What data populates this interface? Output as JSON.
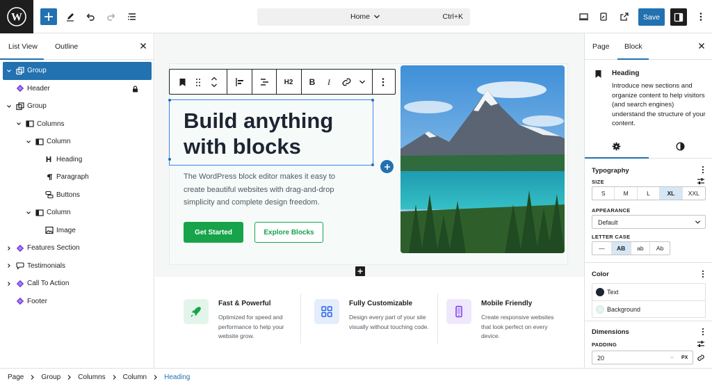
{
  "topbar": {
    "document_title": "Home",
    "shortcut": "Ctrl+K",
    "save_label": "Save"
  },
  "list_view": {
    "tabs": [
      "List View",
      "Outline"
    ],
    "items": [
      {
        "label": "Group",
        "level": 0,
        "chevron": "down",
        "icon": "group",
        "selected": true
      },
      {
        "label": "Header",
        "level": 0,
        "chevron": "none",
        "icon": "pattern",
        "locked": true
      },
      {
        "label": "Group",
        "level": 0,
        "chevron": "down",
        "icon": "group"
      },
      {
        "label": "Columns",
        "level": 1,
        "chevron": "down",
        "icon": "columns"
      },
      {
        "label": "Column",
        "level": 2,
        "chevron": "down",
        "icon": "column"
      },
      {
        "label": "Heading",
        "level": 3,
        "chevron": "none",
        "icon": "heading"
      },
      {
        "label": "Paragraph",
        "level": 3,
        "chevron": "none",
        "icon": "paragraph"
      },
      {
        "label": "Buttons",
        "level": 3,
        "chevron": "none",
        "icon": "buttons"
      },
      {
        "label": "Column",
        "level": 2,
        "chevron": "down",
        "icon": "column"
      },
      {
        "label": "Image",
        "level": 3,
        "chevron": "none",
        "icon": "image"
      },
      {
        "label": "Features Section",
        "level": 0,
        "chevron": "right",
        "icon": "pattern"
      },
      {
        "label": "Testimonials",
        "level": 0,
        "chevron": "right",
        "icon": "quote"
      },
      {
        "label": "Call To Action",
        "level": 0,
        "chevron": "right",
        "icon": "pattern"
      },
      {
        "label": "Footer",
        "level": 0,
        "chevron": "none",
        "icon": "pattern"
      }
    ]
  },
  "block_toolbar": {
    "heading_level": "H2"
  },
  "hero": {
    "heading": "Build anything with blocks",
    "paragraph": "The WordPress block editor makes it easy to create beautiful websites with drag-and-drop simplicity and complete design freedom.",
    "primary_button": "Get Started",
    "secondary_button": "Explore Blocks"
  },
  "features": [
    {
      "title": "Fast & Powerful",
      "description": "Optimized for speed and performance to help your website grow.",
      "icon": "rocket-icon",
      "color": "#16a34a",
      "bg": "#e3f5ea"
    },
    {
      "title": "Fully Customizable",
      "description": "Design every part of your site visually without touching code.",
      "icon": "grid-icon",
      "color": "#2563eb",
      "bg": "#e4edfb"
    },
    {
      "title": "Mobile Friendly",
      "description": "Create responsive websites that look perfect on every device.",
      "icon": "mobile-icon",
      "color": "#7c3aed",
      "bg": "#efe7fb"
    }
  ],
  "inspector": {
    "tabs": [
      "Page",
      "Block"
    ],
    "block_name": "Heading",
    "block_description": "Introduce new sections and organize content to help visitors (and search engines) understand the structure of your content.",
    "typography": {
      "title": "Typography",
      "size_label": "SIZE",
      "sizes": [
        "S",
        "M",
        "L",
        "XL",
        "XXL"
      ],
      "size_active": "XL",
      "appearance_label": "APPEARANCE",
      "appearance_value": "Default",
      "letter_case_label": "LETTER CASE",
      "letter_cases": [
        "—",
        "AB",
        "ab",
        "Ab"
      ],
      "letter_case_active": "AB"
    },
    "color": {
      "title": "Color",
      "text_label": "Text",
      "text_swatch": "#1d2533",
      "background_label": "Background",
      "background_swatch": "#e6f4ee"
    },
    "dimensions": {
      "title": "Dimensions",
      "padding_label": "PADDING",
      "padding_value": "20",
      "unit": "PX"
    }
  },
  "breadcrumb": [
    "Page",
    "Group",
    "Columns",
    "Column",
    "Heading"
  ],
  "colors": {
    "accent": "#2271b1",
    "primary_green": "#16a34a",
    "heading_text": "#1d2533"
  }
}
